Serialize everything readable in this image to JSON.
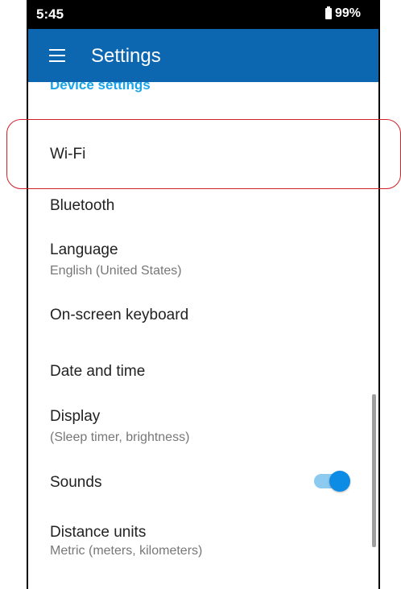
{
  "status_bar": {
    "time": "5:45",
    "battery": "99%"
  },
  "app_bar": {
    "title": "Settings"
  },
  "section": {
    "header": "Device settings"
  },
  "items": [
    {
      "title": "Wi-Fi",
      "subtitle": ""
    },
    {
      "title": "Bluetooth",
      "subtitle": ""
    },
    {
      "title": "Language",
      "subtitle": "English (United States)"
    },
    {
      "title": "On-screen keyboard",
      "subtitle": ""
    },
    {
      "title": "Date and time",
      "subtitle": ""
    },
    {
      "title": "Display",
      "subtitle": "(Sleep timer, brightness)"
    },
    {
      "title": "Sounds",
      "subtitle": "",
      "toggle_on": true
    },
    {
      "title": "Distance units",
      "subtitle": "Metric (meters, kilometers)"
    }
  ],
  "colors": {
    "app_bar": "#0d67b0",
    "accent": "#18a3e8",
    "highlight": "#d0202a"
  }
}
